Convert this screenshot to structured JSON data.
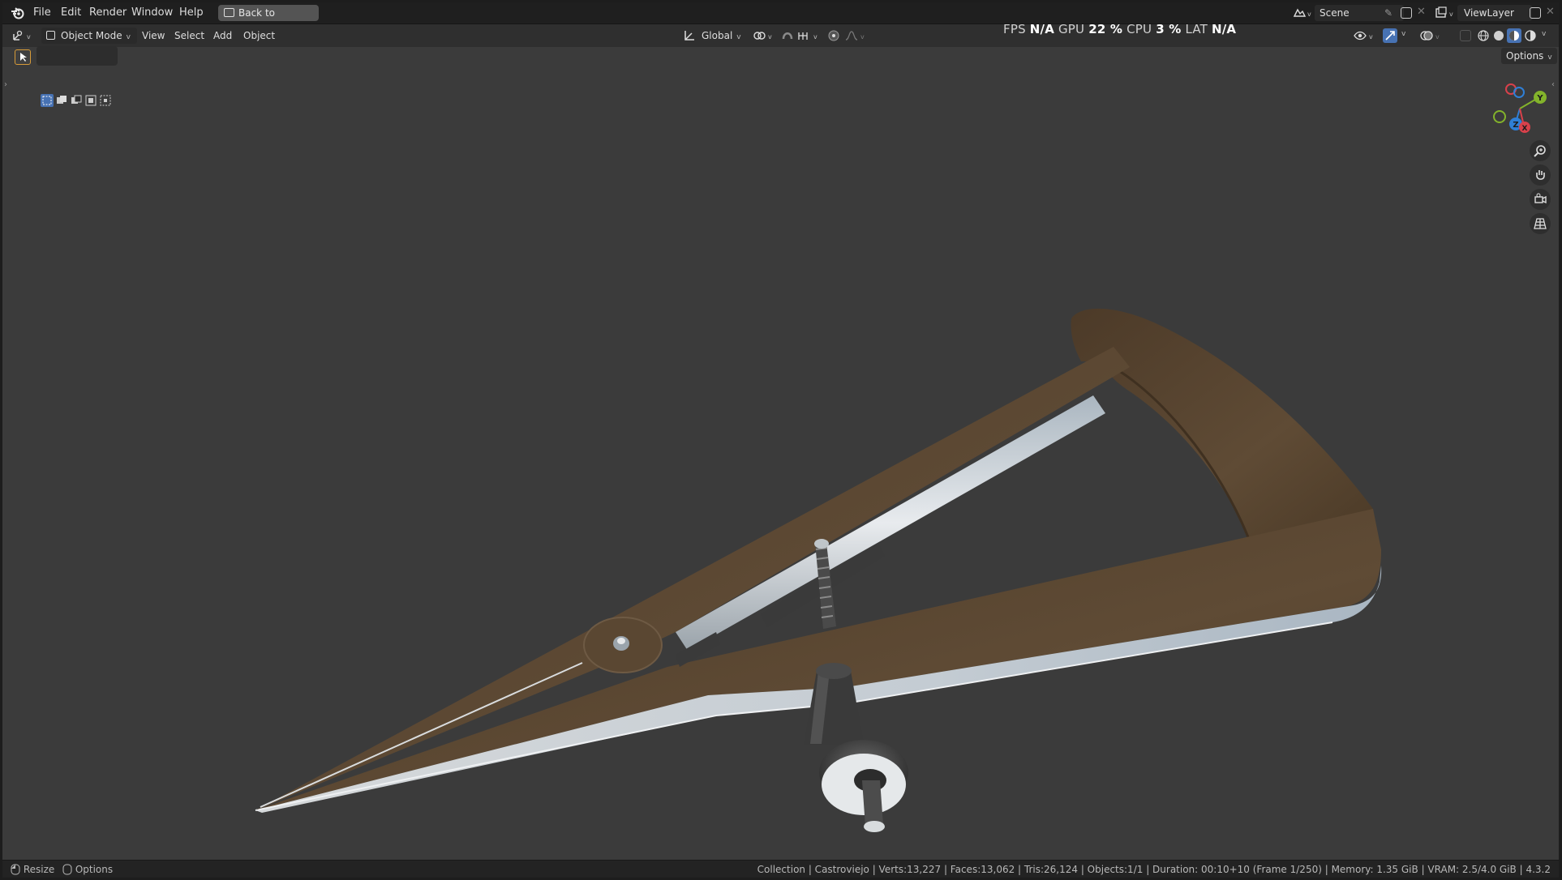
{
  "menu": {
    "file": "File",
    "edit": "Edit",
    "render": "Render",
    "window": "Window",
    "help": "Help",
    "back_button": "Back to Previous"
  },
  "scene": {
    "name": "Scene",
    "view_layer": "ViewLayer"
  },
  "header": {
    "mode": "Object Mode",
    "view": "View",
    "select": "Select",
    "add": "Add",
    "object": "Object",
    "orientation": "Global"
  },
  "perf": {
    "fps_label": "FPS",
    "fps_value": "N/A",
    "gpu_label": "GPU",
    "gpu_value": "22 %",
    "cpu_label": "CPU",
    "cpu_value": "3 %",
    "lat_label": "LAT",
    "lat_value": "N/A"
  },
  "options_label": "Options",
  "gizmo": {
    "y": "Y",
    "z": "Z",
    "x": "X"
  },
  "status": {
    "resize": "Resize",
    "options": "Options",
    "info": "Collection | Castroviejo | Verts:13,227 | Faces:13,062 | Tris:26,124 | Objects:1/1 | Duration: 00:10+10 (Frame 1/250) | Memory: 1.35 GiB | VRAM: 2.5/4.0 GiB | 4.3.2"
  },
  "colors": {
    "accent_blue": "#4772b3",
    "selected_orange": "#d79b38",
    "bronze": "#5e4a34",
    "steel": "#c5ccd2"
  }
}
